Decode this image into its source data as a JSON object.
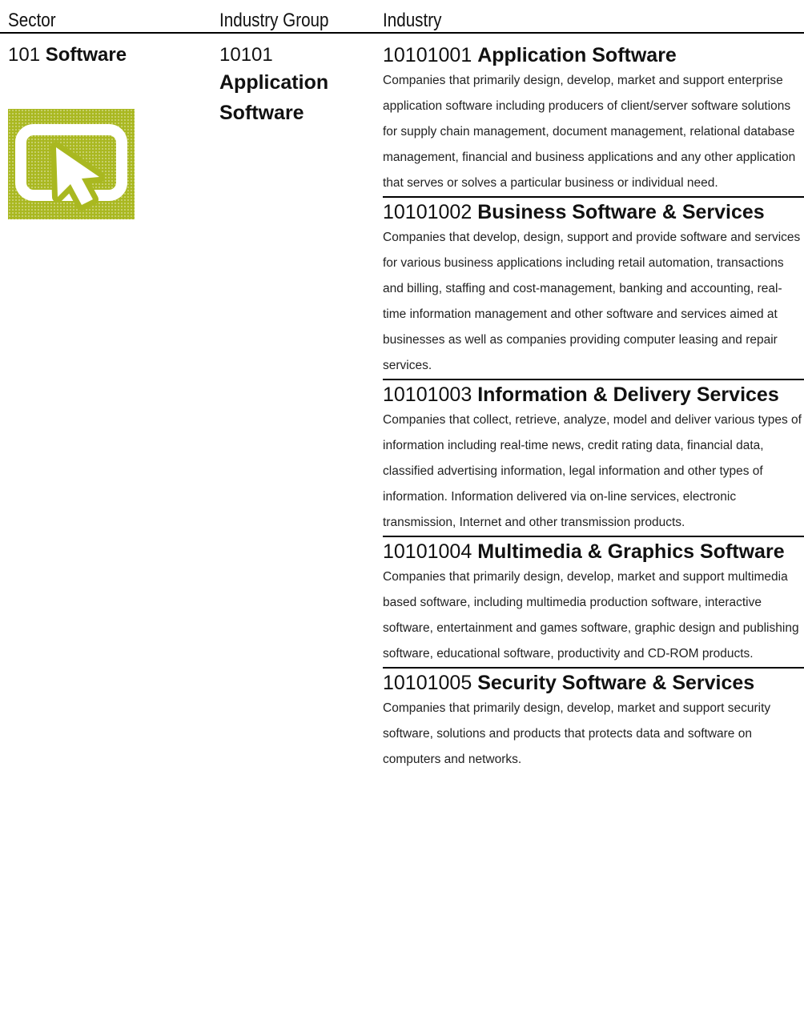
{
  "headers": {
    "sector": "Sector",
    "industry_group": "Industry Group",
    "industry": "Industry"
  },
  "sector": {
    "code": "101",
    "name": "Software",
    "icon": "cursor-arrow-icon",
    "icon_color": "#a9b820"
  },
  "industry_group": {
    "code": "10101",
    "name_line1": "Application",
    "name_line2": "Software"
  },
  "industries": [
    {
      "code": "10101001",
      "name": "Application Software",
      "description": "Companies that primarily design, develop, market and support enterprise application software including producers of client/server software solutions for supply chain management, document management, relational database management, financial and business applications and any other application that serves or solves a particular business or individual need."
    },
    {
      "code": "10101002",
      "name": "Business Software & Services",
      "description": "Companies that develop, design, support and provide software and services for various business applications including retail automation, transactions and billing, staffing and cost-management, banking and accounting, real-time information management and other software and services aimed at businesses as well as companies providing computer leasing and repair services."
    },
    {
      "code": "10101003",
      "name": "Information & Delivery Services",
      "description": "Companies that collect, retrieve, analyze, model and deliver various types of information including real-time news, credit rating data, financial data, classified advertising information, legal information and other types of information. Information delivered via on-line services, electronic transmission, Internet and other transmission products."
    },
    {
      "code": "10101004",
      "name": "Multimedia & Graphics Software",
      "description": "Companies that primarily design, develop, market and support multimedia based software, including multimedia production software, interactive software, entertainment and games software, graphic design and publishing software, educational software, productivity and CD-ROM products."
    },
    {
      "code": "10101005",
      "name": "Security Software & Services",
      "description": "Companies that primarily design, develop, market and support security software, solutions and products that protects data and software on computers and networks."
    }
  ]
}
